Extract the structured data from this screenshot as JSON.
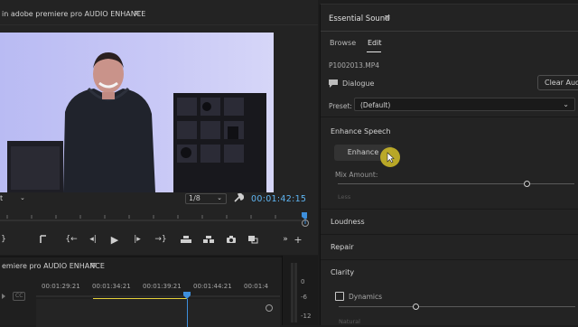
{
  "program_monitor": {
    "title": "in adobe premiere pro AUDIO ENHANCE",
    "menu_glyph": "≡",
    "fit_value": "t",
    "resolution": "1/8",
    "timecode": "00:01:42:15"
  },
  "transport": {
    "mark_in": "{",
    "mark_out": "}",
    "go_to_in": "{←",
    "step_back": "◂|",
    "play": "▶",
    "step_forward": "|▸",
    "go_to_out": "→}",
    "more": "»",
    "add": "+"
  },
  "timeline": {
    "title": "emiere pro AUDIO ENHANCE",
    "menu_glyph": "≡",
    "cc_label": "CC",
    "timecodes": [
      "00:01:29:21",
      "00:01:34:21",
      "00:01:39:21",
      "00:01:44:21",
      "00:01:4"
    ]
  },
  "audio_meter": {
    "labels": [
      "0",
      "-6",
      "-12"
    ]
  },
  "essential_sound": {
    "title": "Essential Sound",
    "menu_glyph": "≡",
    "tabs": [
      "Browse",
      "Edit"
    ],
    "active_tab": "Edit",
    "clip_name": "P1002013.MP4",
    "type_label": "Dialogue",
    "clear_button": "Clear Audio",
    "preset_label": "Preset:",
    "preset_value": "(Default)",
    "enhance_speech": {
      "title": "Enhance Speech",
      "button": "Enhance",
      "mix_label": "Mix Amount:",
      "min_label": "Less",
      "mix_value": 0.8
    },
    "sections": [
      "Loudness",
      "Repair",
      "Clarity"
    ],
    "dynamics_label": "Dynamics",
    "dynamics_checked": false,
    "natural_label": "Natural",
    "dynamics_value": 0.33
  },
  "colors": {
    "timecode_blue": "#5fb5f2",
    "playhead_blue": "#3d8fdc",
    "cursor_highlight": "#d2be28",
    "in_out_yellow": "#e6d23a"
  }
}
